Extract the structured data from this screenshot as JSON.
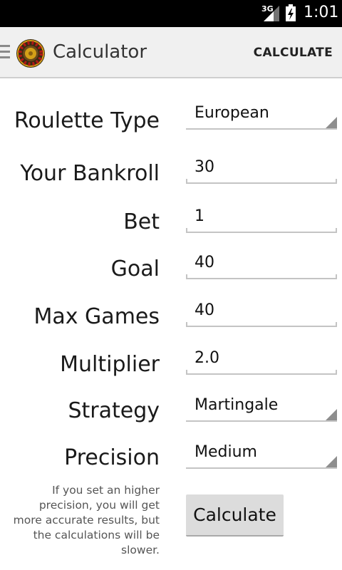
{
  "status_bar": {
    "network": "3G",
    "time": "1:01"
  },
  "action_bar": {
    "title": "Calculator",
    "action_label": "CALCULATE"
  },
  "form": {
    "roulette_type": {
      "label": "Roulette Type",
      "value": "European"
    },
    "bankroll": {
      "label": "Your Bankroll",
      "value": "30"
    },
    "bet": {
      "label": "Bet",
      "value": "1"
    },
    "goal": {
      "label": "Goal",
      "value": "40"
    },
    "max_games": {
      "label": "Max Games",
      "value": "40"
    },
    "multiplier": {
      "label": "Multiplier",
      "value": "2.0"
    },
    "strategy": {
      "label": "Strategy",
      "value": "Martingale"
    },
    "precision": {
      "label": "Precision",
      "value": "Medium"
    }
  },
  "hint": "If you set an higher precision, you will get more accurate results, but the calculations will be slower.",
  "calculate_button": "Calculate",
  "colors": {
    "status_bar": "#000000",
    "action_bar": "#f0f0f0",
    "button": "#dcdcdc"
  }
}
